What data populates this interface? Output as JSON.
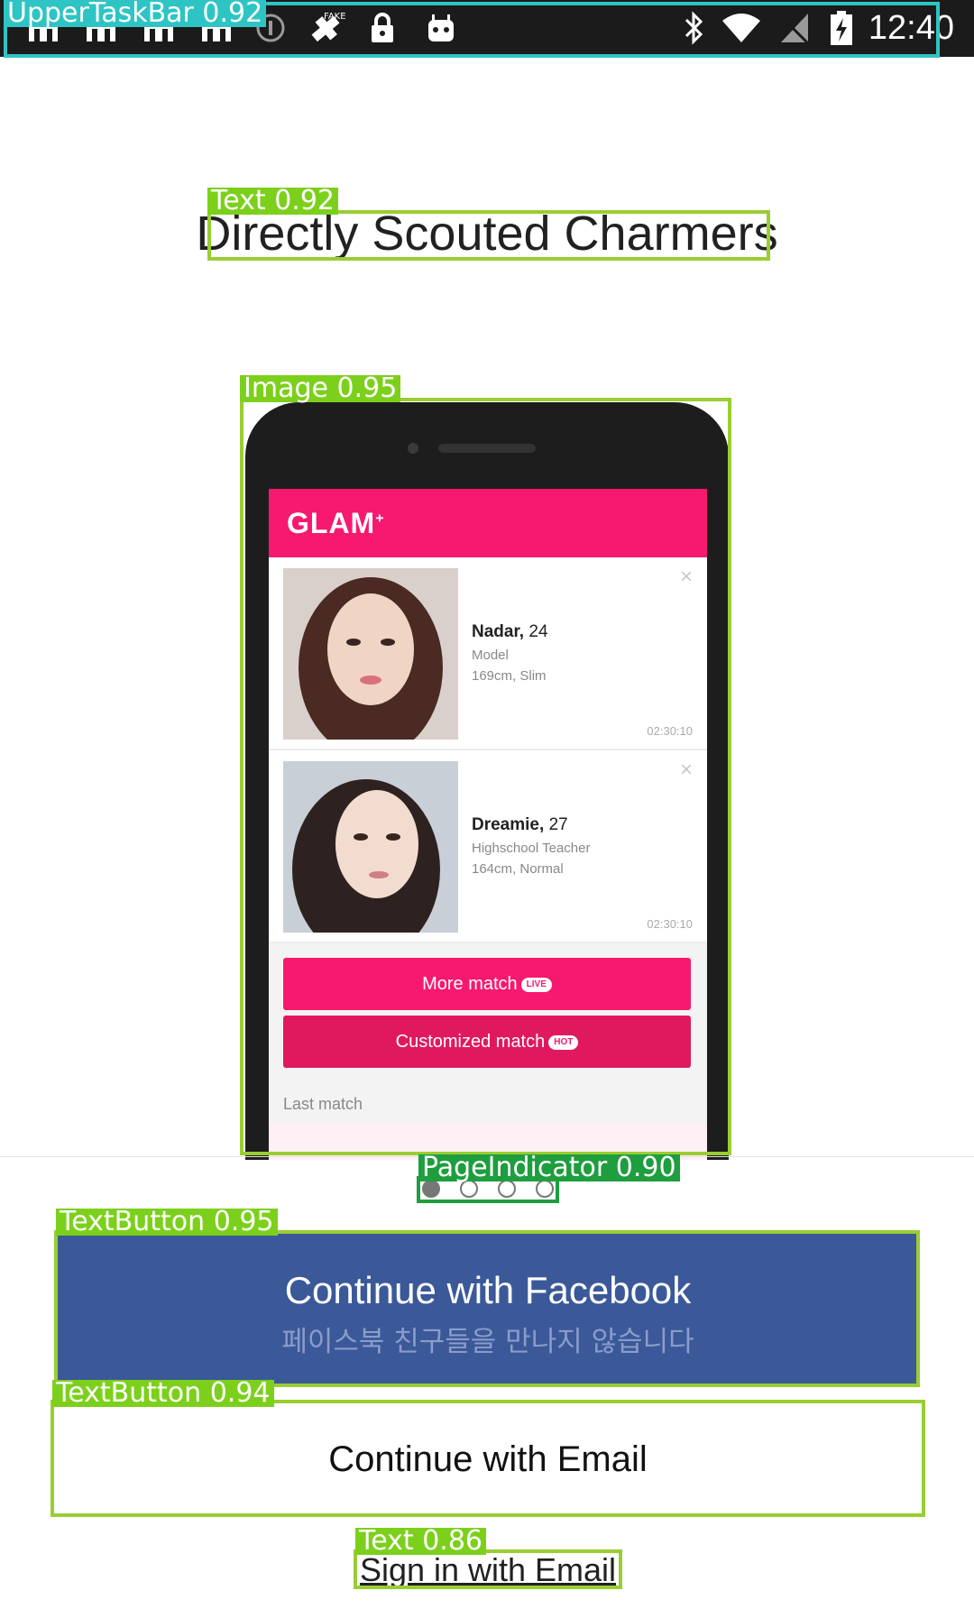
{
  "status_bar": {
    "time": "12:40",
    "icons": [
      "notification-icon",
      "notification-icon",
      "notification-icon",
      "notification-icon",
      "info-icon",
      "fake-gps-icon",
      "lock-icon",
      "android-icon",
      "bluetooth-icon",
      "wifi-icon",
      "no-sim-icon",
      "battery-charging-icon"
    ]
  },
  "header": {
    "title": "Directly Scouted Charmers"
  },
  "preview": {
    "app_name": "GLAM",
    "profiles": [
      {
        "name": "Nadar,",
        "age": "24",
        "job": "Model",
        "body": "169cm, Slim",
        "time": "02:30:10"
      },
      {
        "name": "Dreamie,",
        "age": "27",
        "job": "Highschool Teacher",
        "body": "164cm, Normal",
        "time": "02:30:10"
      }
    ],
    "more_match_label": "More match",
    "more_match_badge": "LIVE",
    "customized_match_label": "Customized match",
    "customized_match_badge": "HOT",
    "last_match_label": "Last match",
    "colors": {
      "accent": "#f7186f",
      "accent_dark": "#e0195f"
    }
  },
  "pager": {
    "pages": 4,
    "active": 0
  },
  "actions": {
    "facebook_label": "Continue with Facebook",
    "facebook_sublabel": "페이스북 친구들을 만나지 않습니다",
    "email_label": "Continue with Email",
    "signin_label": "Sign in with Email",
    "facebook_color": "#3b5998"
  },
  "annotations": [
    {
      "label": "UpperTaskBar 0.92"
    },
    {
      "label": "Text 0.92"
    },
    {
      "label": "Image 0.95"
    },
    {
      "label": "PageIndicator 0.90"
    },
    {
      "label": "TextButton 0.95"
    },
    {
      "label": "TextButton 0.94"
    },
    {
      "label": "Text 0.86"
    }
  ]
}
